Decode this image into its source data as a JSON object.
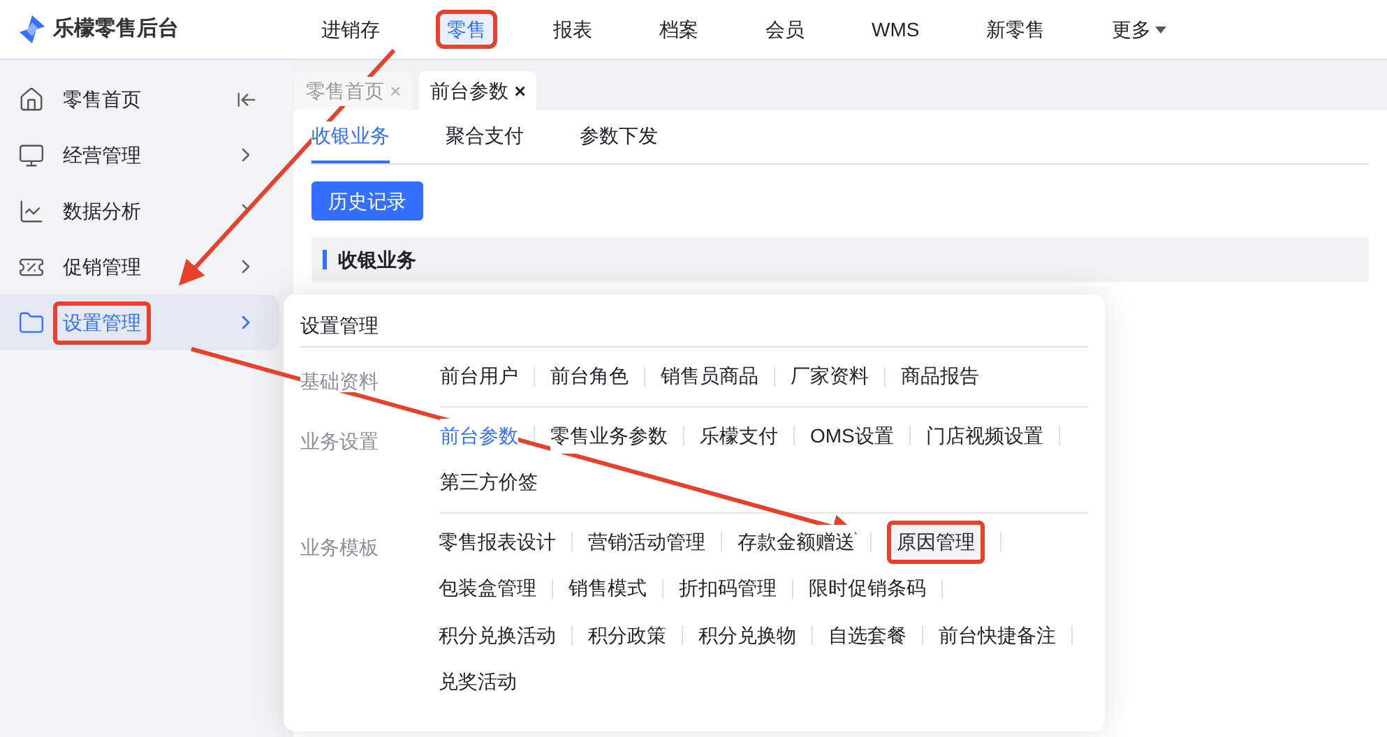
{
  "brand": "乐檬零售后台",
  "nav": [
    {
      "label": "进销存",
      "selected": false,
      "annotated": false
    },
    {
      "label": "零售",
      "selected": true,
      "annotated": true
    },
    {
      "label": "报表",
      "selected": false,
      "annotated": false
    },
    {
      "label": "档案",
      "selected": false,
      "annotated": false
    },
    {
      "label": "会员",
      "selected": false,
      "annotated": false
    },
    {
      "label": "WMS",
      "selected": false,
      "annotated": false
    },
    {
      "label": "新零售",
      "selected": false,
      "annotated": false
    },
    {
      "label": "更多",
      "selected": false,
      "annotated": false,
      "dropdown": true
    }
  ],
  "sidebar": {
    "items": [
      {
        "label": "零售首页",
        "selected": false,
        "annotated": false
      },
      {
        "label": "经营管理",
        "selected": false,
        "annotated": false
      },
      {
        "label": "数据分析",
        "selected": false,
        "annotated": false
      },
      {
        "label": "促销管理",
        "selected": false,
        "annotated": false
      },
      {
        "label": "设置管理",
        "selected": true,
        "annotated": true
      }
    ]
  },
  "page_tabs": [
    {
      "label": "零售首页",
      "selected": false,
      "close": "×"
    },
    {
      "label": "前台参数",
      "selected": true,
      "close": "×"
    }
  ],
  "sub_tabs": [
    {
      "label": "收银业务",
      "selected": true
    },
    {
      "label": "聚合支付",
      "selected": false
    },
    {
      "label": "参数下发",
      "selected": false
    }
  ],
  "history_button": "历史记录",
  "section_title": "收银业务",
  "menu": {
    "title": "设置管理",
    "groups": [
      {
        "label": "基础资料",
        "lines": [
          [
            {
              "label": "前台用户",
              "selected": false,
              "annotated": false
            },
            {
              "label": "前台角色",
              "selected": false,
              "annotated": false
            },
            {
              "label": "销售员商品",
              "selected": false,
              "annotated": false
            },
            {
              "label": "厂家资料",
              "selected": false,
              "annotated": false
            },
            {
              "label": "商品报告",
              "selected": false,
              "annotated": false
            }
          ]
        ]
      },
      {
        "label": "业务设置",
        "lines": [
          [
            {
              "label": "前台参数",
              "selected": true,
              "annotated": false
            },
            {
              "label": "零售业务参数",
              "selected": false,
              "annotated": false
            },
            {
              "label": "乐檬支付",
              "selected": false,
              "annotated": false
            },
            {
              "label": "OMS设置",
              "selected": false,
              "annotated": false
            },
            {
              "label": "门店视频设置",
              "selected": false,
              "annotated": false
            }
          ],
          [
            {
              "label": "第三方价签",
              "selected": false,
              "annotated": false
            }
          ]
        ]
      },
      {
        "label": "业务模板",
        "lines": [
          [
            {
              "label": "零售报表设计",
              "selected": false,
              "annotated": false
            },
            {
              "label": "营销活动管理",
              "selected": false,
              "annotated": false
            },
            {
              "label": "存款金额赠送",
              "selected": false,
              "annotated": false
            },
            {
              "label": "原因管理",
              "selected": false,
              "annotated": true
            }
          ],
          [
            {
              "label": "包装盒管理",
              "selected": false,
              "annotated": false
            },
            {
              "label": "销售模式",
              "selected": false,
              "annotated": false
            },
            {
              "label": "折扣码管理",
              "selected": false,
              "annotated": false
            },
            {
              "label": "限时促销条码",
              "selected": false,
              "annotated": false
            }
          ],
          [
            {
              "label": "积分兑换活动",
              "selected": false,
              "annotated": false
            },
            {
              "label": "积分政策",
              "selected": false,
              "annotated": false
            },
            {
              "label": "积分兑换物",
              "selected": false,
              "annotated": false
            },
            {
              "label": "自选套餐",
              "selected": false,
              "annotated": false
            },
            {
              "label": "前台快捷备注",
              "selected": false,
              "annotated": false
            }
          ],
          [
            {
              "label": "兑奖活动",
              "selected": false,
              "annotated": false
            }
          ]
        ]
      }
    ]
  }
}
